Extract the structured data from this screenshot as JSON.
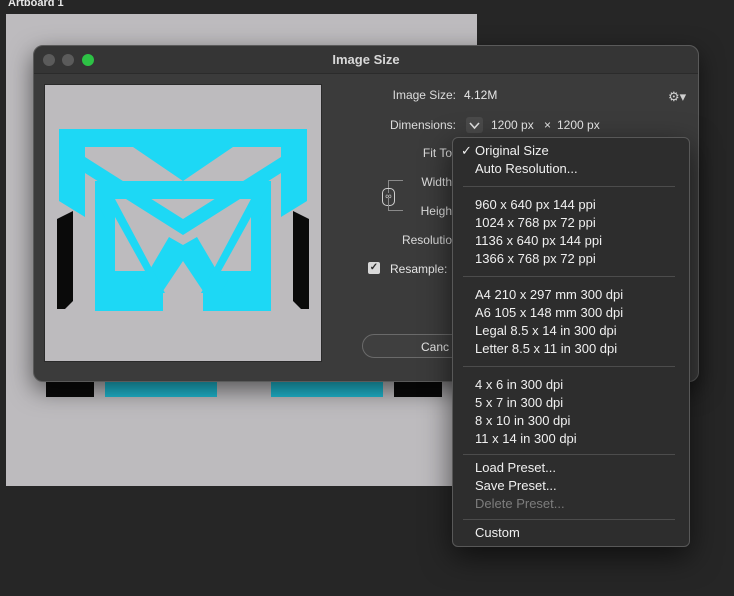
{
  "artboard": {
    "label": "Artboard 1"
  },
  "dialog": {
    "title": "Image Size",
    "image_size_label": "Image Size:",
    "image_size_value": "4.12M",
    "dimensions_label": "Dimensions:",
    "dimensions_width": "1200 px",
    "dimensions_x": "×",
    "dimensions_height": "1200 px",
    "fit_to_label": "Fit To",
    "width_label": "Width",
    "height_label": "Heigh",
    "resolution_label": "Resolutio",
    "resample_label": "Resample:",
    "resample_checked": true,
    "cancel_label": "Canc",
    "logo_colors": {
      "cyan": "#1dd8f5",
      "shadow": "#0a0a0a"
    }
  },
  "menu": {
    "selected": "Original Size",
    "groups": [
      [
        "Original Size",
        "Auto Resolution..."
      ],
      [
        "960 x 640 px 144 ppi",
        "1024 x 768 px 72 ppi",
        "1136 x 640 px 144 ppi",
        "1366 x 768 px 72 ppi"
      ],
      [
        "A4 210 x 297 mm 300 dpi",
        "A6 105 x 148 mm 300 dpi",
        "Legal 8.5 x 14 in 300 dpi",
        "Letter 8.5 x 11 in 300 dpi"
      ],
      [
        "4 x 6 in 300 dpi",
        "5 x 7 in 300 dpi",
        "8 x 10 in 300 dpi",
        "11 x 14 in 300 dpi"
      ],
      [
        "Load Preset...",
        "Save Preset...",
        "Delete Preset..."
      ],
      [
        "Custom"
      ]
    ],
    "disabled": [
      "Delete Preset..."
    ]
  }
}
